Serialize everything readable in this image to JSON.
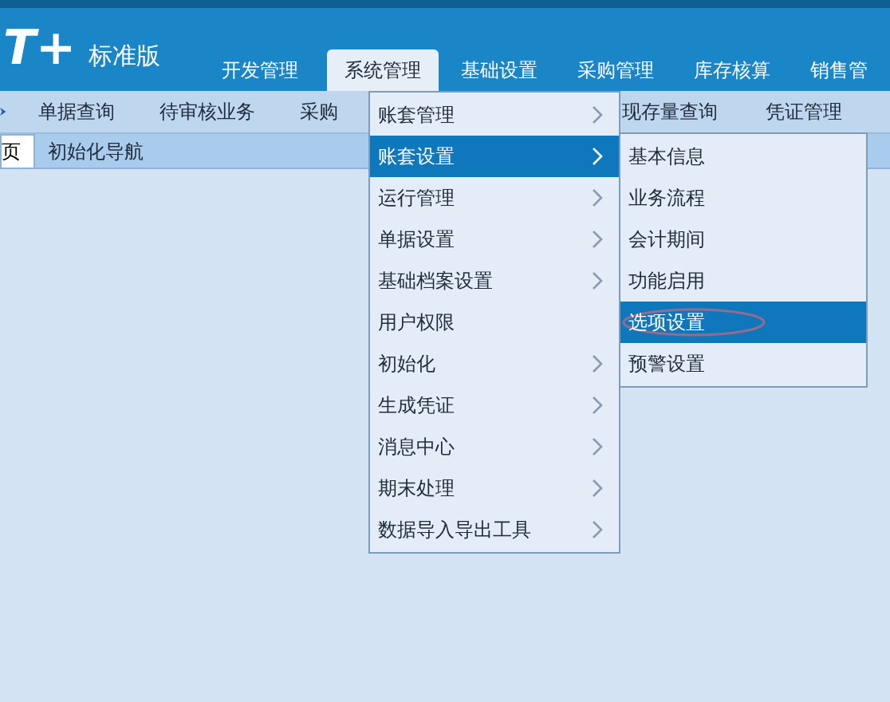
{
  "logo": {
    "mark": "T+",
    "edition": "标准版"
  },
  "nav_tabs": [
    {
      "label": "开发管理",
      "selected": false
    },
    {
      "label": "系统管理",
      "selected": true
    },
    {
      "label": "基础设置",
      "selected": false
    },
    {
      "label": "采购管理",
      "selected": false
    },
    {
      "label": "库存核算",
      "selected": false
    },
    {
      "label": "销售管",
      "selected": false
    }
  ],
  "toolbar": {
    "left": [
      "单据查询",
      "待审核业务",
      "采购"
    ],
    "right": [
      "现存量查询",
      "凭证管理"
    ]
  },
  "page_tabs": [
    {
      "label": "页",
      "selected": true
    },
    {
      "label": "初始化导航",
      "selected": false
    }
  ],
  "menu": [
    {
      "label": "账套管理",
      "has_submenu": true,
      "selected": false
    },
    {
      "label": "账套设置",
      "has_submenu": true,
      "selected": true
    },
    {
      "label": "运行管理",
      "has_submenu": true,
      "selected": false
    },
    {
      "label": "单据设置",
      "has_submenu": true,
      "selected": false
    },
    {
      "label": "基础档案设置",
      "has_submenu": true,
      "selected": false
    },
    {
      "label": "用户权限",
      "has_submenu": false,
      "selected": false
    },
    {
      "label": "初始化",
      "has_submenu": true,
      "selected": false
    },
    {
      "label": "生成凭证",
      "has_submenu": true,
      "selected": false
    },
    {
      "label": "消息中心",
      "has_submenu": true,
      "selected": false
    },
    {
      "label": "期末处理",
      "has_submenu": true,
      "selected": false
    },
    {
      "label": "数据导入导出工具",
      "has_submenu": true,
      "selected": false
    }
  ],
  "submenu": [
    {
      "label": "基本信息",
      "selected": false,
      "circled": false
    },
    {
      "label": "业务流程",
      "selected": false,
      "circled": false
    },
    {
      "label": "会计期间",
      "selected": false,
      "circled": false
    },
    {
      "label": "功能启用",
      "selected": false,
      "circled": false
    },
    {
      "label": "选项设置",
      "selected": true,
      "circled": true
    },
    {
      "label": "预警设置",
      "selected": false,
      "circled": false
    }
  ]
}
